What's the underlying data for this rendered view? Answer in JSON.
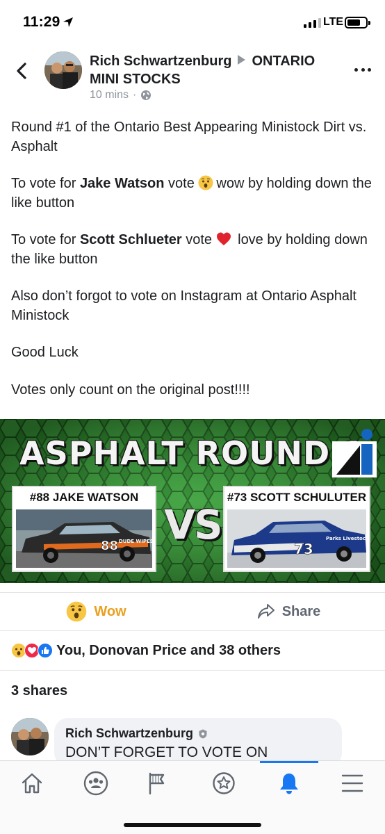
{
  "status_bar": {
    "time": "11:29",
    "network": "LTE"
  },
  "post": {
    "author": "Rich Schwartzenburg",
    "group": "ONTARIO MINI STOCKS",
    "timestamp": "10 mins",
    "separator": "·",
    "paragraphs": {
      "p1": "Round #1 of the Ontario Best Appearing Ministock Dirt vs. Asphalt",
      "p2_pre": "To vote for ",
      "p2_name": "Jake Watson",
      "p2_mid": " vote ",
      "p2_post": "wow by holding down the like button",
      "p3_pre": "To vote for ",
      "p3_name": "Scott Schlueter",
      "p3_mid": " vote ",
      "p3_post": " love by holding down the like button",
      "p4": "Also don’t forgot to vote on Instagram at Ontario Asphalt Ministock",
      "p5": "Good Luck",
      "p6": "Votes only count on the original post!!!!"
    }
  },
  "graphic": {
    "title": "ASPHALT ROUND 1",
    "vs": "VS",
    "left_label": "#88 JAKE WATSON",
    "right_label": "#73 SCOTT SCHULUTER",
    "left_car_number": "88",
    "left_car_text": "DUDE WIPES",
    "right_car_number": "73",
    "right_car_text": "Parks Livestock"
  },
  "actions": {
    "wow_label": "Wow",
    "share_label": "Share"
  },
  "reactions_summary": "You, Donovan Price and 38 others",
  "shares_text": "3 shares",
  "comment": {
    "author": "Rich Schwartzenburg",
    "text": "DON’T FORGET TO VOTE ON"
  },
  "tabbar": {
    "tabs": [
      "home-icon",
      "groups-icon",
      "pages-flag-icon",
      "badge-icon",
      "notifications-bell-icon",
      "menu-icon"
    ],
    "active": "notifications-bell-icon",
    "accent": "#1877f2"
  },
  "colors": {
    "text": "#1c1e21",
    "meta": "#90949c",
    "wow": "#e9a01e",
    "graphic_green": "#2a7a2a"
  }
}
